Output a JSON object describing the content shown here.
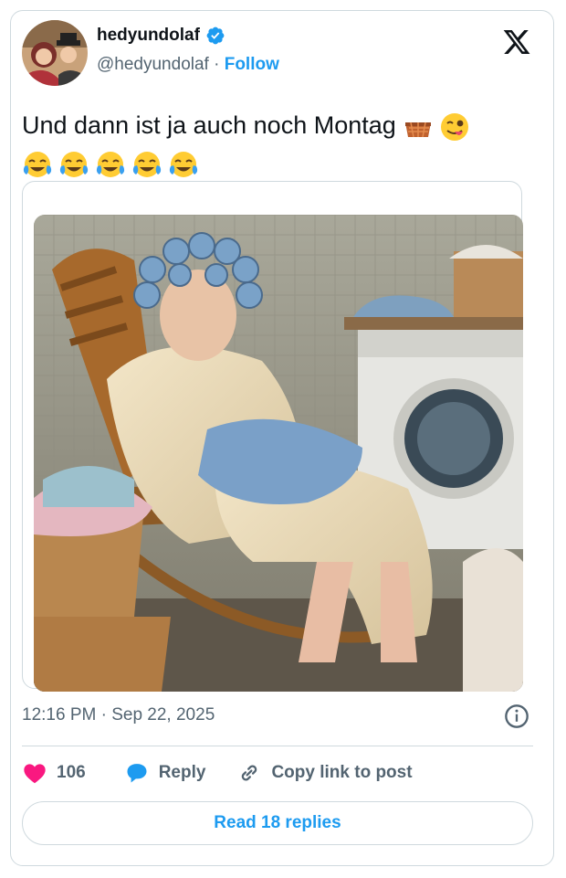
{
  "author": {
    "display_name": "hedyundolaf",
    "handle": "@hedyundolaf",
    "separator": " · ",
    "follow_label": "Follow"
  },
  "post": {
    "text": "Und dann ist ja auch noch Montag ",
    "emojis_line1": [
      "basket-emoji",
      "winking-tongue-emoji"
    ],
    "emojis_line2": [
      "tears-of-joy-emoji",
      "tears-of-joy-emoji",
      "tears-of-joy-emoji",
      "tears-of-joy-emoji",
      "tears-of-joy-emoji"
    ]
  },
  "meta": {
    "timestamp": "12:16 PM · Sep 22, 2025"
  },
  "actions": {
    "likes_count": "106",
    "reply_label": "Reply",
    "copy_label": "Copy link to post"
  },
  "footer": {
    "read_replies_label": "Read 18 replies"
  },
  "colors": {
    "accent": "#1d9bf0",
    "like": "#f91880",
    "border": "#cfd9de",
    "muted": "#536471"
  },
  "icons": {
    "platform": "x-logo-icon",
    "verified": "verified-badge-icon",
    "info": "info-icon",
    "like": "heart-icon",
    "reply": "reply-bubble-icon",
    "copy": "link-icon"
  }
}
